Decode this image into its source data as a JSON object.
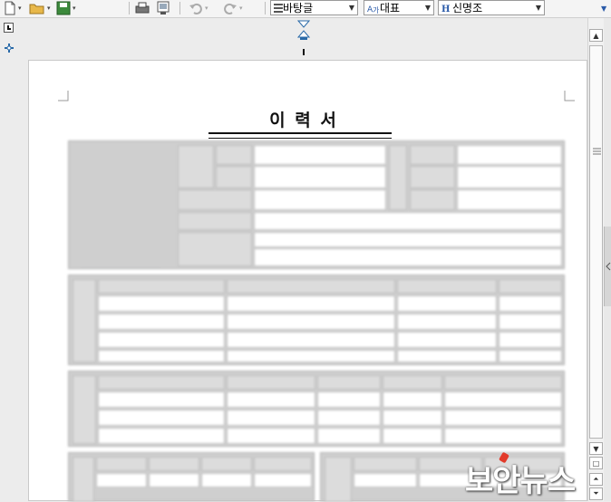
{
  "toolbar": {
    "style_combo": "바탕글",
    "lang_combo": "대표",
    "font_combo": "신명조"
  },
  "document": {
    "title": "이 력 서"
  },
  "watermark": {
    "text": "보안뉴스"
  },
  "colors": {
    "toolbar_bg": "#f4f4f4",
    "workspace_bg": "#ececec",
    "page_bg": "#ffffff",
    "table_header": "#dcdcdc"
  },
  "icons": [
    "new-document-icon",
    "open-folder-icon",
    "save-icon",
    "print-icon",
    "print-preview-icon",
    "undo-icon",
    "redo-icon",
    "style-icon",
    "language-icon",
    "font-icon",
    "tab-marker-icon",
    "ruler-toggle-icon"
  ]
}
